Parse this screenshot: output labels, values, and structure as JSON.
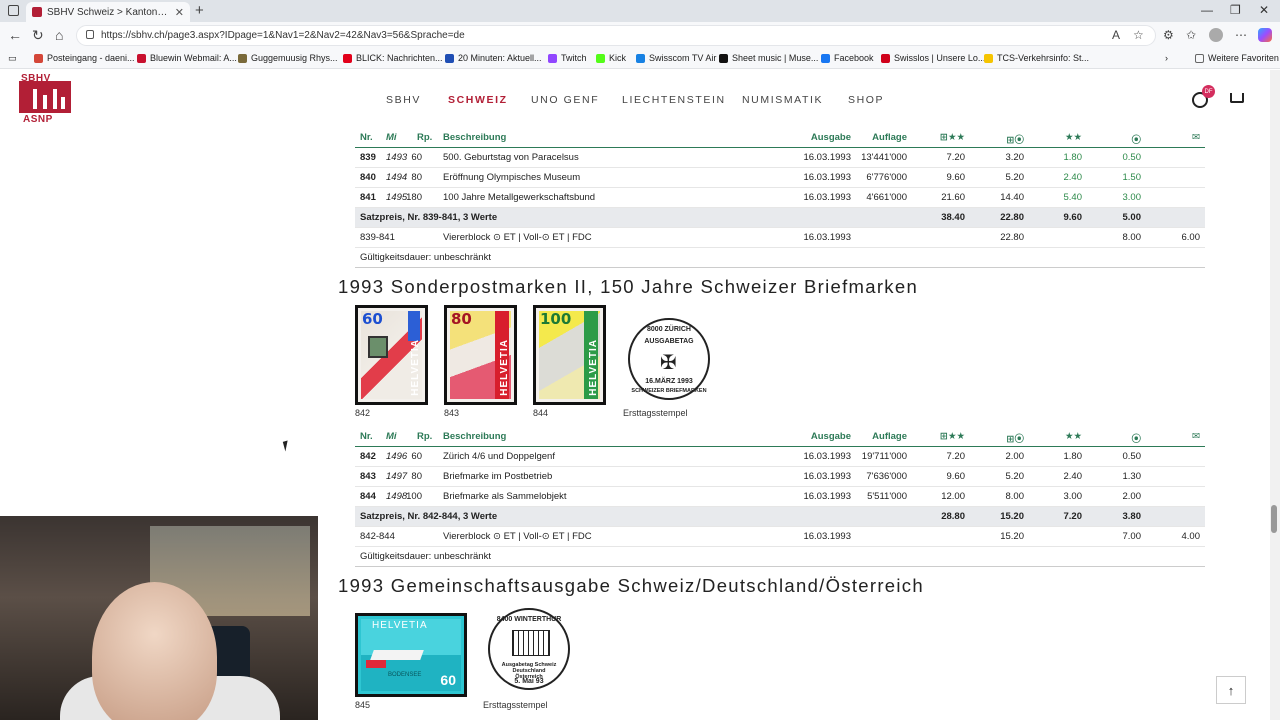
{
  "browser": {
    "tab_title": "SBHV Schweiz > Kantonal- und F...",
    "url": "https://sbhv.ch/page3.aspx?IDpage=1&Nav1=2&Nav2=42&Nav3=56&Sprache=de",
    "more_favorites": "Weitere Favoriten",
    "bookmarks": [
      {
        "label": "Posteingang - daeni...",
        "color": "#d44638"
      },
      {
        "label": "Bluewin Webmail: A...",
        "color": "#c8102e"
      },
      {
        "label": "Guggemuusig Rhys...",
        "color": "#7a6a3a"
      },
      {
        "label": "BLICK: Nachrichten...",
        "color": "#e2001a"
      },
      {
        "label": "20 Minuten: Aktuell...",
        "color": "#1f4eb4"
      },
      {
        "label": "Twitch",
        "color": "#9146ff"
      },
      {
        "label": "Kick",
        "color": "#53fc18"
      },
      {
        "label": "Swisscom TV Air",
        "color": "#1781e3"
      },
      {
        "label": "Sheet music | Muse...",
        "color": "#111111"
      },
      {
        "label": "Facebook",
        "color": "#1877f2"
      },
      {
        "label": "Swisslos | Unsere Lo...",
        "color": "#d0021b"
      },
      {
        "label": "TCS-Verkehrsinfo: St...",
        "color": "#f5c400"
      }
    ]
  },
  "site": {
    "logo_top": "SBHV",
    "logo_bottom": "ASNP",
    "nav": [
      "SBHV",
      "SCHWEIZ",
      "UNO GENF",
      "LIECHTENSTEIN",
      "NUMISMATIK",
      "SHOP"
    ],
    "user_badge": "DF",
    "to_top": "↑"
  },
  "header_cols": {
    "nr": "Nr.",
    "mi": "Mi",
    "rp": "Rp.",
    "desc": "Beschreibung",
    "ausgabe": "Ausgabe",
    "auflage": "Auflage",
    "c1": "⊞★★",
    "c2": "⊞⦿",
    "c3": "★★",
    "c4": "⦿",
    "c5": "✉"
  },
  "table1": {
    "rows": [
      {
        "nr": "839",
        "mi": "1493",
        "rp": "60",
        "desc": "500. Geburtstag von Paracelsus",
        "ausgabe": "16.03.1993",
        "auflage": "13'441'000",
        "c1": "7.20",
        "c2": "3.20",
        "c3": "1.80",
        "c4": "0.50",
        "c5": ""
      },
      {
        "nr": "840",
        "mi": "1494",
        "rp": "80",
        "desc": "Eröffnung Olympisches Museum",
        "ausgabe": "16.03.1993",
        "auflage": "6'776'000",
        "c1": "9.60",
        "c2": "5.20",
        "c3": "2.40",
        "c4": "1.50",
        "c5": ""
      },
      {
        "nr": "841",
        "mi": "1495",
        "rp": "180",
        "desc": "100 Jahre Metallgewerkschaftsbund",
        "ausgabe": "16.03.1993",
        "auflage": "4'661'000",
        "c1": "21.60",
        "c2": "14.40",
        "c3": "5.40",
        "c4": "3.00",
        "c5": ""
      }
    ],
    "sum": {
      "label": "Satzpreis, Nr. 839-841, 3 Werte",
      "c1": "38.40",
      "c2": "22.80",
      "c3": "9.60",
      "c4": "5.00"
    },
    "block": {
      "nr": "839-841",
      "desc": "Viererblock ⊙ ET | Voll-⊙ ET | FDC",
      "ausgabe": "16.03.1993",
      "c2": "22.80",
      "c4": "8.00",
      "c5": "6.00"
    },
    "gueltig": "Gültigkeitsdauer: unbeschränkt"
  },
  "section2": {
    "title": "1993 Sonderpostmarken II, 150 Jahre Schweizer Briefmarken",
    "stamps": [
      {
        "nr": "842",
        "value": "60",
        "text": "HELVETIA"
      },
      {
        "nr": "843",
        "value": "80",
        "text": "HELVETIA"
      },
      {
        "nr": "844",
        "value": "100",
        "text": "HELVETIA"
      }
    ],
    "cancel_label": "Ersttagsstempel",
    "cancel_top": "8000 ZÜRICH",
    "cancel_mid": "AUSGABETAG",
    "cancel_date": "16.MÄRZ 1993",
    "cancel_bottom": "SCHWEIZER BRIEFMARKEN"
  },
  "table2": {
    "rows": [
      {
        "nr": "842",
        "mi": "1496",
        "rp": "60",
        "desc": "Zürich 4/6 und Doppelgenf",
        "ausgabe": "16.03.1993",
        "auflage": "19'711'000",
        "c1": "7.20",
        "c2": "2.00",
        "c3": "1.80",
        "c4": "0.50",
        "c5": ""
      },
      {
        "nr": "843",
        "mi": "1497",
        "rp": "80",
        "desc": "Briefmarke im Postbetrieb",
        "ausgabe": "16.03.1993",
        "auflage": "7'636'000",
        "c1": "9.60",
        "c2": "5.20",
        "c3": "2.40",
        "c4": "1.30",
        "c5": ""
      },
      {
        "nr": "844",
        "mi": "1498",
        "rp": "100",
        "desc": "Briefmarke als Sammelobjekt",
        "ausgabe": "16.03.1993",
        "auflage": "5'511'000",
        "c1": "12.00",
        "c2": "8.00",
        "c3": "3.00",
        "c4": "2.00",
        "c5": ""
      }
    ],
    "sum": {
      "label": "Satzpreis, Nr. 842-844, 3 Werte",
      "c1": "28.80",
      "c2": "15.20",
      "c3": "7.20",
      "c4": "3.80"
    },
    "block": {
      "nr": "842-844",
      "desc": "Viererblock ⊙ ET | Voll-⊙ ET | FDC",
      "ausgabe": "16.03.1993",
      "c2": "15.20",
      "c4": "7.00",
      "c5": "4.00"
    },
    "gueltig": "Gültigkeitsdauer: unbeschränkt"
  },
  "section3": {
    "title": "1993 Gemeinschaftsausgabe Schweiz/Deutschland/Österreich",
    "stamp": {
      "nr": "845",
      "value": "60",
      "text": "HELVETIA",
      "sub": "BODENSEE"
    },
    "cancel_label": "Ersttagsstempel",
    "cancel_top": "8400 WINTERTHUR",
    "cancel_mid": "Ausgabetag Schweiz Deutschland Österreich",
    "cancel_date": "5. Mai 93"
  }
}
